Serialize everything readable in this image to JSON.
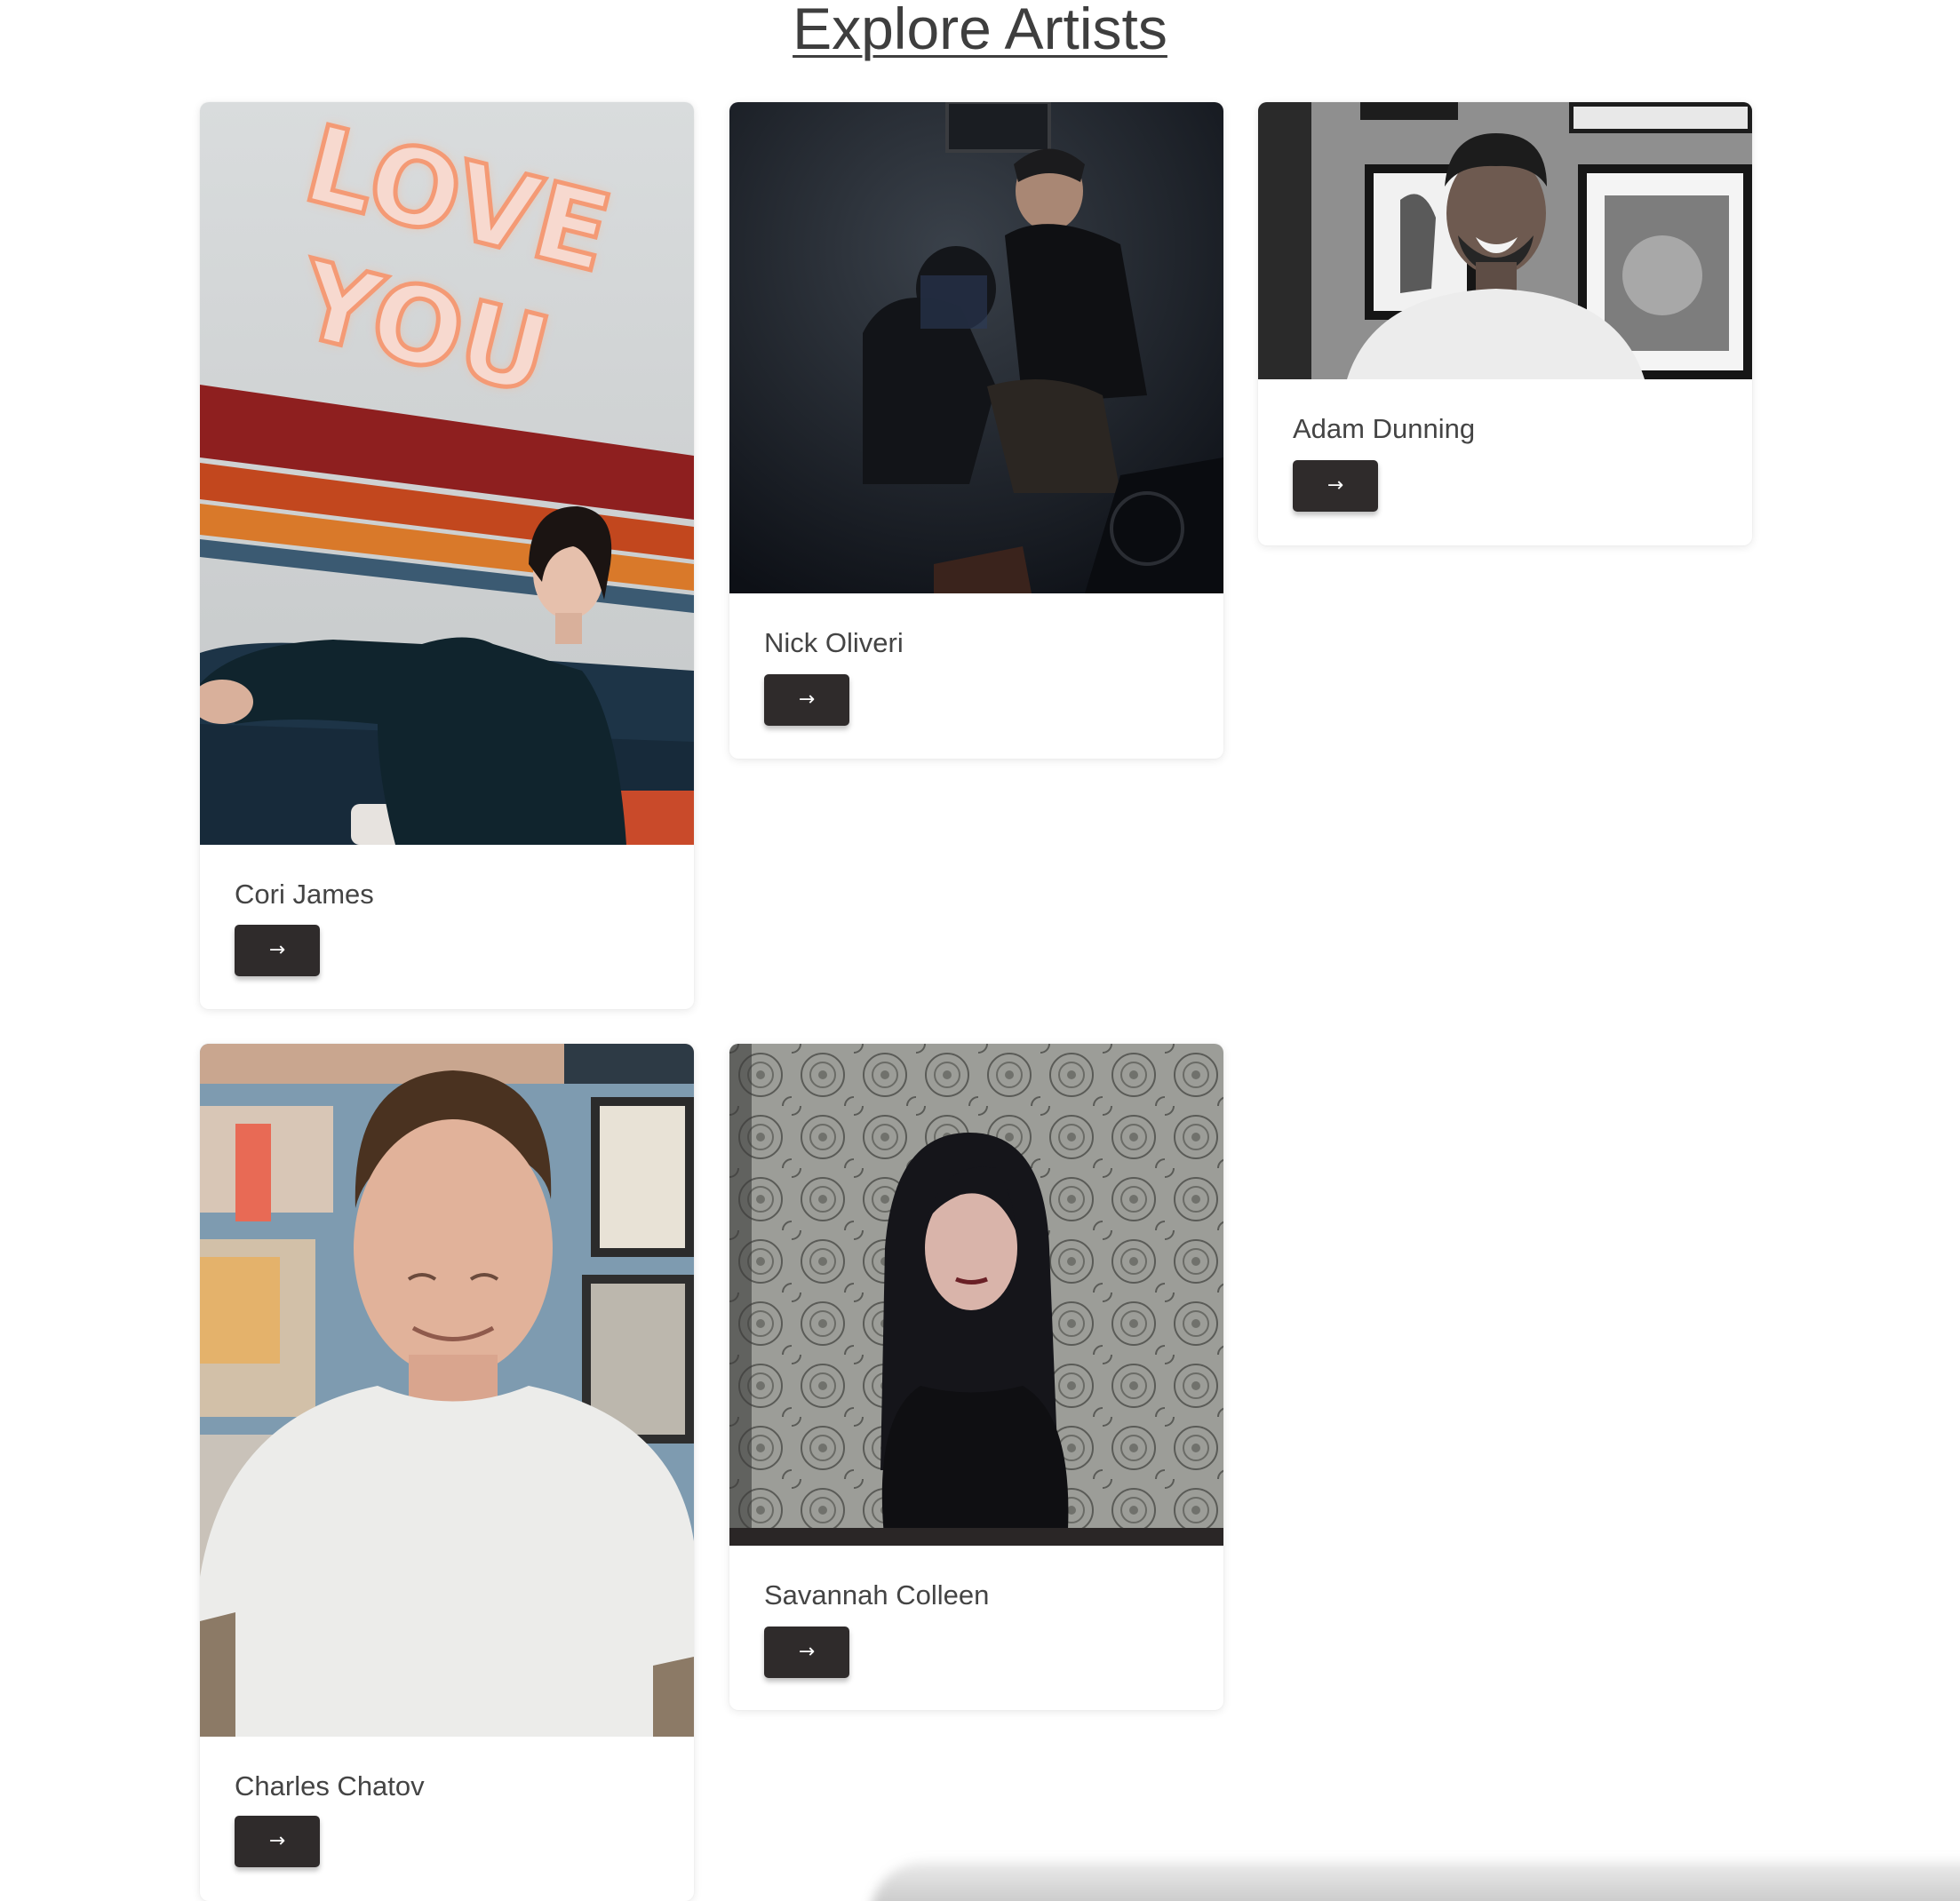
{
  "page": {
    "title": "Explore Artists"
  },
  "artists": [
    {
      "name": "Cori James",
      "button_label": "→"
    },
    {
      "name": "Nick Oliveri",
      "button_label": "→"
    },
    {
      "name": "Adam Dunning",
      "button_label": "→"
    },
    {
      "name": "Charles Chatov",
      "button_label": "→"
    },
    {
      "name": "Savannah Colleen",
      "button_label": "→"
    }
  ],
  "photos": {
    "cori_james": {
      "neon_sign": "LOVE YOU"
    }
  },
  "colors": {
    "button_bg": "#2f2b2b",
    "text": "#444444",
    "title": "#3e3e3e"
  }
}
